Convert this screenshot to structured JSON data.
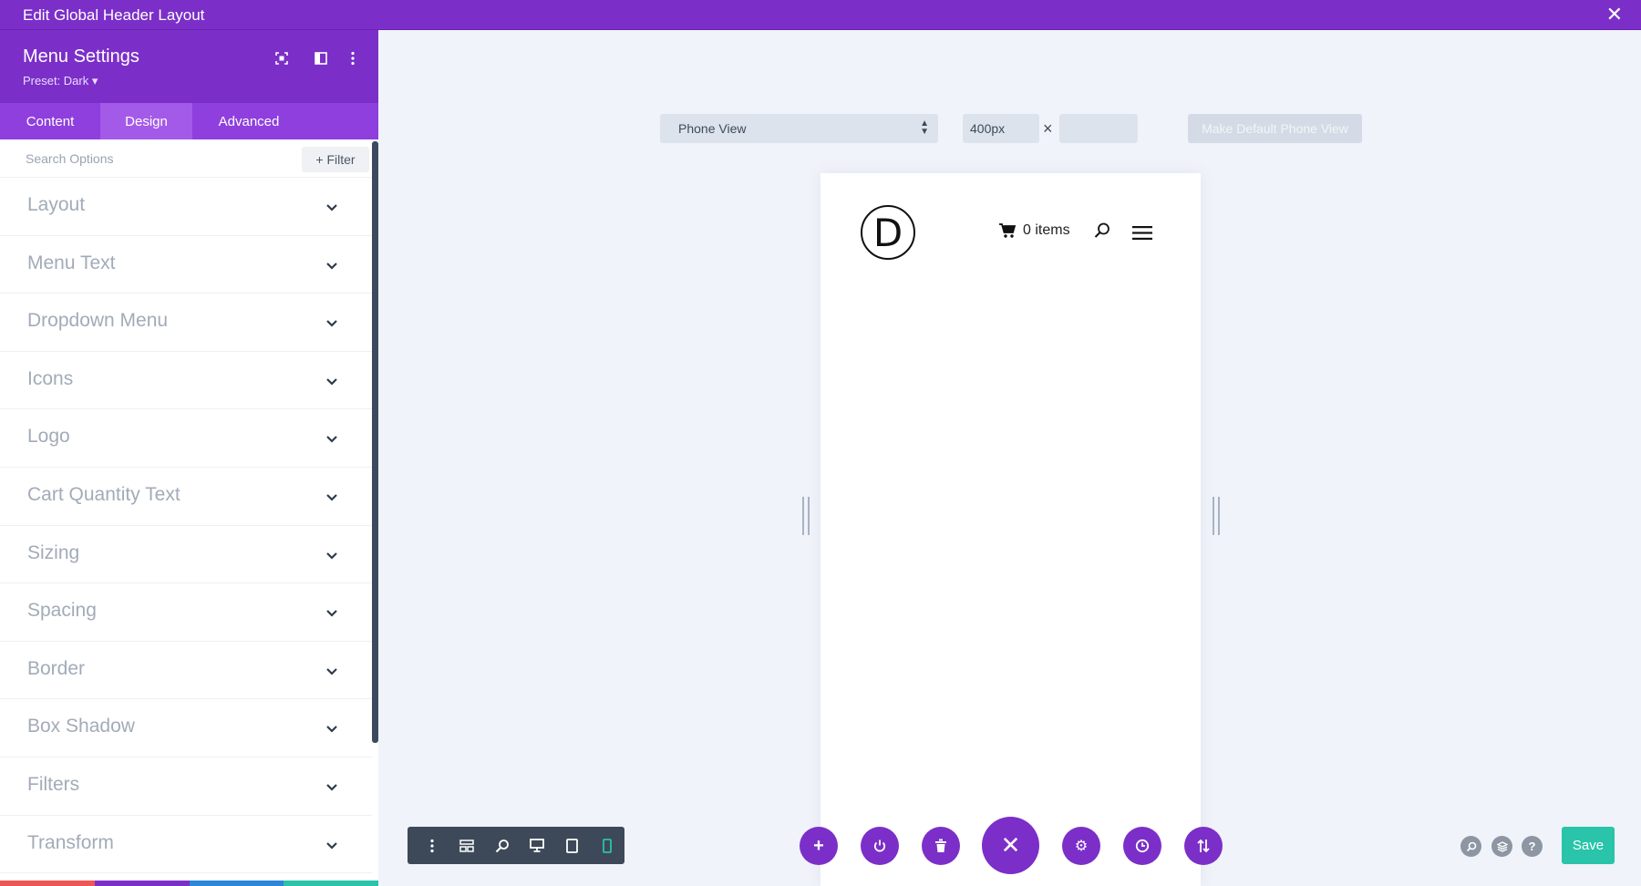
{
  "window": {
    "title": "Edit Global Header Layout",
    "close_icon": "close-icon"
  },
  "sidebar": {
    "title": "Menu Settings",
    "preset": "Preset: Dark ▾",
    "header_icons": [
      "focus-icon",
      "split-view-icon",
      "more-vertical-icon"
    ],
    "tabs": [
      {
        "label": "Content",
        "active": false
      },
      {
        "label": "Design",
        "active": true
      },
      {
        "label": "Advanced",
        "active": false
      }
    ],
    "search_placeholder": "Search Options",
    "filter_label": "+ Filter",
    "options": [
      "Layout",
      "Menu Text",
      "Dropdown Menu",
      "Icons",
      "Logo",
      "Cart Quantity Text",
      "Sizing",
      "Spacing",
      "Border",
      "Box Shadow",
      "Filters",
      "Transform"
    ],
    "footer_buttons": [
      {
        "name": "discard",
        "icon": "close-icon",
        "color": "#ef5555"
      },
      {
        "name": "undo",
        "icon": "undo-icon",
        "color": "#7b2fc8"
      },
      {
        "name": "redo",
        "icon": "redo-icon",
        "color": "#2b87da"
      },
      {
        "name": "save-changes",
        "icon": "check-icon",
        "color": "#29c4a9"
      }
    ]
  },
  "viewport": {
    "view_select": "Phone View",
    "width_value": "400px",
    "times": "×",
    "height_value": "",
    "default_button": "Make Default Phone View"
  },
  "preview": {
    "logo_letter": "D",
    "cart_text": "0 items"
  },
  "builder": {
    "device_buttons": [
      "more-vertical-icon",
      "wireframe-icon",
      "zoom-icon",
      "desktop-icon",
      "tablet-icon",
      "phone-icon"
    ],
    "fab_buttons": [
      "add-icon",
      "power-icon",
      "trash-icon",
      "close-icon",
      "gear-icon",
      "history-icon",
      "sort-icon"
    ],
    "right_icons": [
      "search-icon",
      "layers-icon",
      "help-icon"
    ],
    "save_label": "Save"
  },
  "colors": {
    "brand_purple": "#7b2fc8",
    "save_green": "#29c4a9",
    "active_device": "#29c4a9"
  }
}
